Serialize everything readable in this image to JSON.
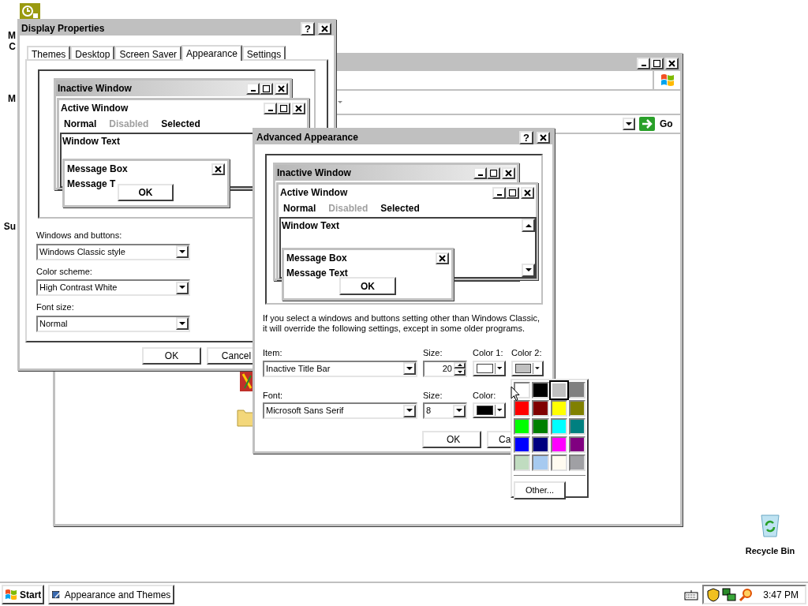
{
  "desktop_icons": [
    {
      "lines": [
        "M",
        "C"
      ]
    },
    {
      "lines": [
        "M"
      ]
    },
    {
      "lines": [
        "Su"
      ]
    }
  ],
  "recycle_bin": {
    "label": "Recycle Bin"
  },
  "background_window": {
    "go_button": "Go"
  },
  "display_properties": {
    "title": "Display Properties",
    "help": "?",
    "tabs": [
      {
        "label": "Themes",
        "selected": false
      },
      {
        "label": "Desktop",
        "selected": false
      },
      {
        "label": "Screen Saver",
        "selected": false
      },
      {
        "label": "Appearance",
        "selected": true
      },
      {
        "label": "Settings",
        "selected": false
      }
    ],
    "preview": {
      "inactive_title": "Inactive Window",
      "active_title": "Active Window",
      "menu": [
        {
          "label": "Normal",
          "disabled": false
        },
        {
          "label": "Disabled",
          "disabled": true
        },
        {
          "label": "Selected",
          "disabled": false
        }
      ],
      "window_text": "Window Text",
      "message_box_title": "Message Box",
      "message_text": "Message T",
      "ok": "OK"
    },
    "fields": [
      {
        "label": "Windows and buttons:",
        "value": "Windows Classic style"
      },
      {
        "label": "Color scheme:",
        "value": "High Contrast White"
      },
      {
        "label": "Font size:",
        "value": "Normal"
      }
    ],
    "buttons": [
      "OK",
      "Cancel"
    ]
  },
  "advanced_appearance": {
    "title": "Advanced Appearance",
    "help": "?",
    "preview": {
      "inactive_title": "Inactive Window",
      "active_title": "Active Window",
      "menu": [
        {
          "label": "Normal",
          "disabled": false
        },
        {
          "label": "Disabled",
          "disabled": true
        },
        {
          "label": "Selected",
          "disabled": false
        }
      ],
      "window_text": "Window Text",
      "message_box_title": "Message Box",
      "message_text": "Message Text",
      "ok": "OK"
    },
    "note": "If you select a windows and buttons setting other than Windows Classic, it will override the following settings, except in some older programs.",
    "item": {
      "label": "Item:",
      "value": "Inactive Title Bar"
    },
    "item_size": {
      "label": "Size:",
      "value": "20"
    },
    "color_1": {
      "label": "Color 1:",
      "color": "#ffffff"
    },
    "color_2": {
      "label": "Color 2:",
      "color": "#c0c0c0"
    },
    "font": {
      "label": "Font:",
      "value": "Microsoft Sans Serif"
    },
    "font_size": {
      "label": "Size:",
      "value": "8"
    },
    "font_color": {
      "label": "Color:",
      "color": "#000000"
    },
    "buttons": [
      "OK",
      "Ca"
    ]
  },
  "color_popup": {
    "swatches": [
      {
        "color": "#ffffff",
        "selected": false
      },
      {
        "color": "#000000",
        "selected": false
      },
      {
        "color": "#c0c0c0",
        "selected": true
      },
      {
        "color": "#808080",
        "selected": false
      },
      {
        "color": "#ff0000",
        "selected": false
      },
      {
        "color": "#800000",
        "selected": false
      },
      {
        "color": "#ffff00",
        "selected": false
      },
      {
        "color": "#808000",
        "selected": false
      },
      {
        "color": "#00ff00",
        "selected": false
      },
      {
        "color": "#008000",
        "selected": false
      },
      {
        "color": "#00ffff",
        "selected": false
      },
      {
        "color": "#008080",
        "selected": false
      },
      {
        "color": "#0000ff",
        "selected": false
      },
      {
        "color": "#000080",
        "selected": false
      },
      {
        "color": "#ff00ff",
        "selected": false
      },
      {
        "color": "#800080",
        "selected": false
      },
      {
        "color": "#c0dcc0",
        "selected": false
      },
      {
        "color": "#a6caf0",
        "selected": false
      },
      {
        "color": "#fffbf0",
        "selected": false
      },
      {
        "color": "#a0a0a4",
        "selected": false
      }
    ],
    "other_button": "Other..."
  },
  "taskbar": {
    "start": "Start",
    "tasks": [
      "Appearance and Themes"
    ],
    "clock": "3:47 PM"
  }
}
